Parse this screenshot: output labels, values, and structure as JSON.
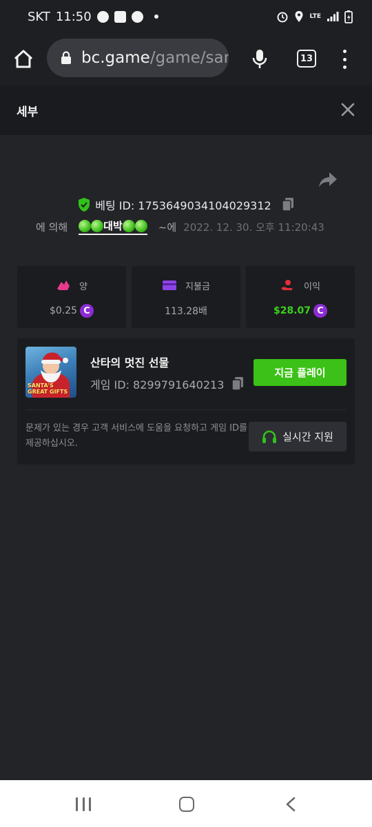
{
  "status_bar": {
    "carrier": "SKT",
    "time": "11:50",
    "network": "LTE"
  },
  "browser": {
    "url_host": "bc.game",
    "url_path": "/game/santa",
    "tab_count": "13"
  },
  "modal": {
    "title": "세부"
  },
  "bet": {
    "id_label": "베팅 ID: 1753649034104029312",
    "by_label": "에 의해",
    "user_name": "대박",
    "at_label": "~에",
    "datetime": "2022. 12. 30. 오후 11:20:43"
  },
  "stats": [
    {
      "title": "양",
      "value": "$0.25",
      "has_coin": true,
      "color": "#a8a9ad",
      "icon": "bet-amount-icon",
      "icon_color": "#e83a8c"
    },
    {
      "title": "지불금",
      "value": "113.28배",
      "has_coin": false,
      "color": "#a8a9ad",
      "icon": "payout-card-icon",
      "icon_color": "#8d44e6"
    },
    {
      "title": "이익",
      "value": "$28.07",
      "has_coin": true,
      "color": "#3bd11f",
      "icon": "profit-hand-icon",
      "icon_color": "#e0303a"
    }
  ],
  "coin_symbol": "C",
  "game": {
    "title": "산타의 멋진 선물",
    "id_label": "게임 ID: 8299791640213",
    "thumb_text": "SANTA'S GREAT GIFTS",
    "play_label": "지금 플레이",
    "help_text": "문제가 있는 경우 고객 서비스에 도움을 요청하고 게임 ID를 제공하십시오.",
    "support_label": "실시간 지원"
  },
  "colors": {
    "accent_green": "#3bc117",
    "coin_purple": "#8d2cd4",
    "background": "#232428",
    "card": "#1b1c1f"
  }
}
